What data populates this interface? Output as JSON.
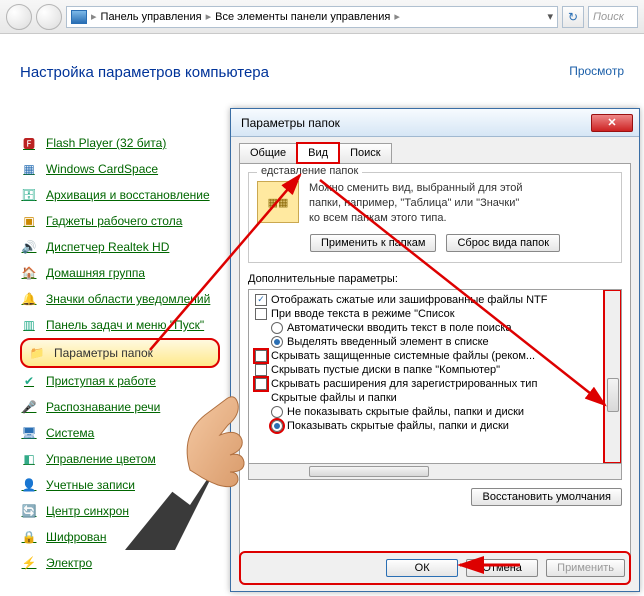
{
  "breadcrumb": {
    "part1": "Панель управления",
    "part2": "Все элементы панели управления"
  },
  "search_placeholder": "Поиск",
  "page_title": "Настройка параметров компьютера",
  "view_label": "Просмотр",
  "cp_items": [
    {
      "label": "Flash Player (32 бита)",
      "icon": "🅵",
      "color": "#b22"
    },
    {
      "label": "Windows CardSpace",
      "icon": "▦",
      "color": "#2a6fb4"
    },
    {
      "label": "Архивация и восстановление",
      "icon": "🗄",
      "color": "#2a8"
    },
    {
      "label": "Гаджеты рабочего стола",
      "icon": "▣",
      "color": "#c80"
    },
    {
      "label": "Диспетчер Realtek HD",
      "icon": "🔊",
      "color": "#d70"
    },
    {
      "label": "Домашняя группа",
      "icon": "🏠",
      "color": "#3a8"
    },
    {
      "label": "Значки области уведомлений",
      "icon": "🔔",
      "color": "#1a6"
    },
    {
      "label": "Панель задач и меню \"Пуск\"",
      "icon": "▥",
      "color": "#2a8"
    },
    {
      "label": "Параметры папок",
      "icon": "📁",
      "color": "#daa520",
      "highlighted": true
    },
    {
      "label": "Приступая к работе",
      "icon": "✔",
      "color": "#2a8"
    },
    {
      "label": "Распознавание речи",
      "icon": "🎤",
      "color": "#2a8"
    },
    {
      "label": "Система",
      "icon": "🖥",
      "color": "#2a6fb4"
    },
    {
      "label": "Управление цветом",
      "icon": "◧",
      "color": "#3a8"
    },
    {
      "label": "Учетные записи",
      "icon": "👤",
      "color": "#2a8"
    },
    {
      "label": "Центр синхрон",
      "icon": "🔄",
      "color": "#2a8"
    },
    {
      "label": "Шифрован",
      "icon": "🔒",
      "color": "#2a8"
    },
    {
      "label": "Электро",
      "icon": "⚡",
      "color": "#2a8"
    }
  ],
  "dialog": {
    "title": "Параметры папок",
    "tabs": {
      "general": "Общие",
      "view": "Вид",
      "search": "Поиск"
    },
    "group": {
      "title": "едставление папок",
      "text_line1": "Можно сменить вид, выбранный для этой",
      "text_line2": "папки, например, \"Таблица\" или \"Значки\"",
      "text_line3": "ко всем папкам этого типа.",
      "apply_btn": "Применить к папкам",
      "reset_btn": "Сброс вида папок"
    },
    "adv_label": "Дополнительные параметры:",
    "adv_rows": [
      {
        "kind": "chk",
        "sel": true,
        "marked": false,
        "indent": 0,
        "text": "Отображать сжатые или зашифрованные файлы NTF"
      },
      {
        "kind": "chk",
        "sel": false,
        "marked": false,
        "indent": 0,
        "text": "При вводе текста в режиме \"Список"
      },
      {
        "kind": "rad",
        "sel": false,
        "marked": false,
        "indent": 1,
        "text": "Автоматически вводить текст в поле поиска"
      },
      {
        "kind": "rad",
        "sel": true,
        "marked": false,
        "indent": 1,
        "text": "Выделять введенный элемент в списке"
      },
      {
        "kind": "chk",
        "sel": false,
        "marked": true,
        "indent": 0,
        "text": "Скрывать защищенные системные файлы (реком..."
      },
      {
        "kind": "chk",
        "sel": false,
        "marked": false,
        "indent": 0,
        "text": "Скрывать пустые диски в папке \"Компьютер\""
      },
      {
        "kind": "chk",
        "sel": false,
        "marked": true,
        "indent": 0,
        "text": "Скрывать расширения для зарегистрированных тип"
      },
      {
        "kind": "none",
        "sel": false,
        "marked": false,
        "indent": 0,
        "text": "Скрытые файлы и папки"
      },
      {
        "kind": "rad",
        "sel": false,
        "marked": false,
        "indent": 1,
        "text": "Не показывать скрытые файлы, папки и диски"
      },
      {
        "kind": "rad",
        "sel": true,
        "marked": true,
        "indent": 1,
        "text": "Показывать скрытые файлы, папки и диски"
      }
    ],
    "restore_btn": "Восстановить умолчания",
    "ok_btn": "ОК",
    "cancel_btn": "Отмена",
    "apply_btn": "Применить"
  }
}
